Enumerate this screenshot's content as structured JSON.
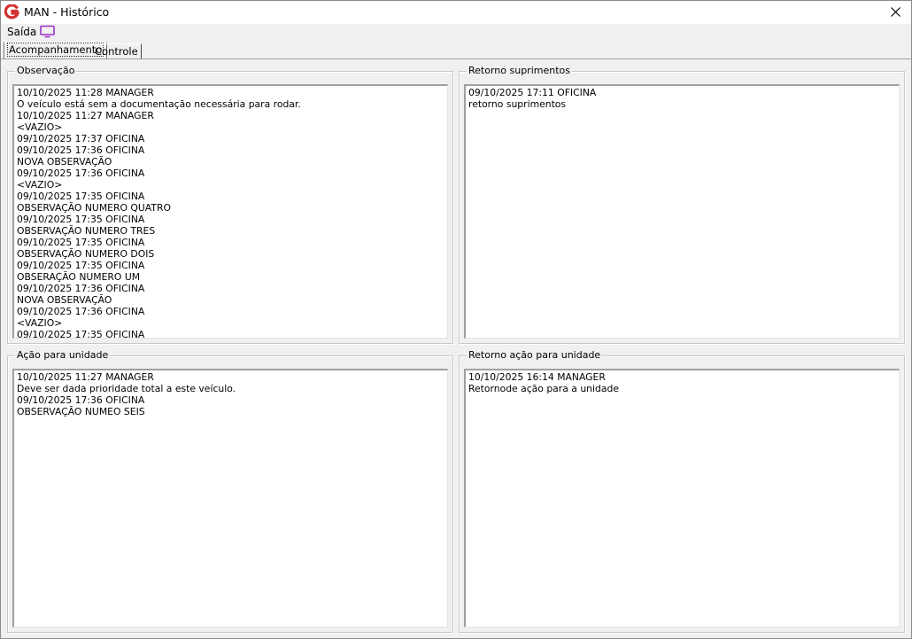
{
  "window": {
    "title": "MAN - Histórico",
    "close_icon": "close-icon",
    "app_icon": "app-logo-icon",
    "accent": "#d32f2f"
  },
  "menu": {
    "saida_label": "Saída",
    "monitor_icon": "monitor-icon",
    "monitor_color": "#9b2fc9"
  },
  "tabs": [
    {
      "label": "Acompanhamento",
      "active": true
    },
    {
      "label": "Controle",
      "active": false
    }
  ],
  "groups": {
    "observacao": {
      "label": "Observação",
      "lines": [
        "10/10/2025 11:28 MANAGER",
        "O veículo está sem a documentação necessária para rodar.",
        "10/10/2025 11:27 MANAGER",
        "<VAZIO>",
        "09/10/2025 17:37 OFICINA",
        "09/10/2025 17:36 OFICINA",
        "NOVA OBSERVAÇÃO",
        "09/10/2025 17:36 OFICINA",
        "<VAZIO>",
        "09/10/2025 17:35 OFICINA",
        "OBSERVAÇÃO NUMERO QUATRO",
        "09/10/2025 17:35 OFICINA",
        "OBSERVAÇÃO NUMERO TRES",
        "09/10/2025 17:35 OFICINA",
        "OBSERVAÇÃO NUMERO DOIS",
        "09/10/2025 17:35 OFICINA",
        "OBSERAÇÃO NUMERO UM",
        "09/10/2025 17:36 OFICINA",
        "NOVA OBSERVAÇÃO",
        "09/10/2025 17:36 OFICINA",
        "<VAZIO>",
        "09/10/2025 17:35 OFICINA"
      ]
    },
    "retorno_suprimentos": {
      "label": "Retorno suprimentos",
      "lines": [
        "09/10/2025 17:11 OFICINA",
        "retorno suprimentos"
      ]
    },
    "acao_unidade": {
      "label": "Ação para unidade",
      "lines": [
        "10/10/2025 11:27 MANAGER",
        "Deve ser dada prioridade total a este veículo.",
        "09/10/2025 17:36 OFICINA",
        "OBSERVAÇÃO NUMEO SEIS"
      ]
    },
    "retorno_acao_unidade": {
      "label": "Retorno ação para unidade",
      "lines": [
        "10/10/2025 16:14 MANAGER",
        "Retornode ação para a unidade"
      ]
    }
  }
}
